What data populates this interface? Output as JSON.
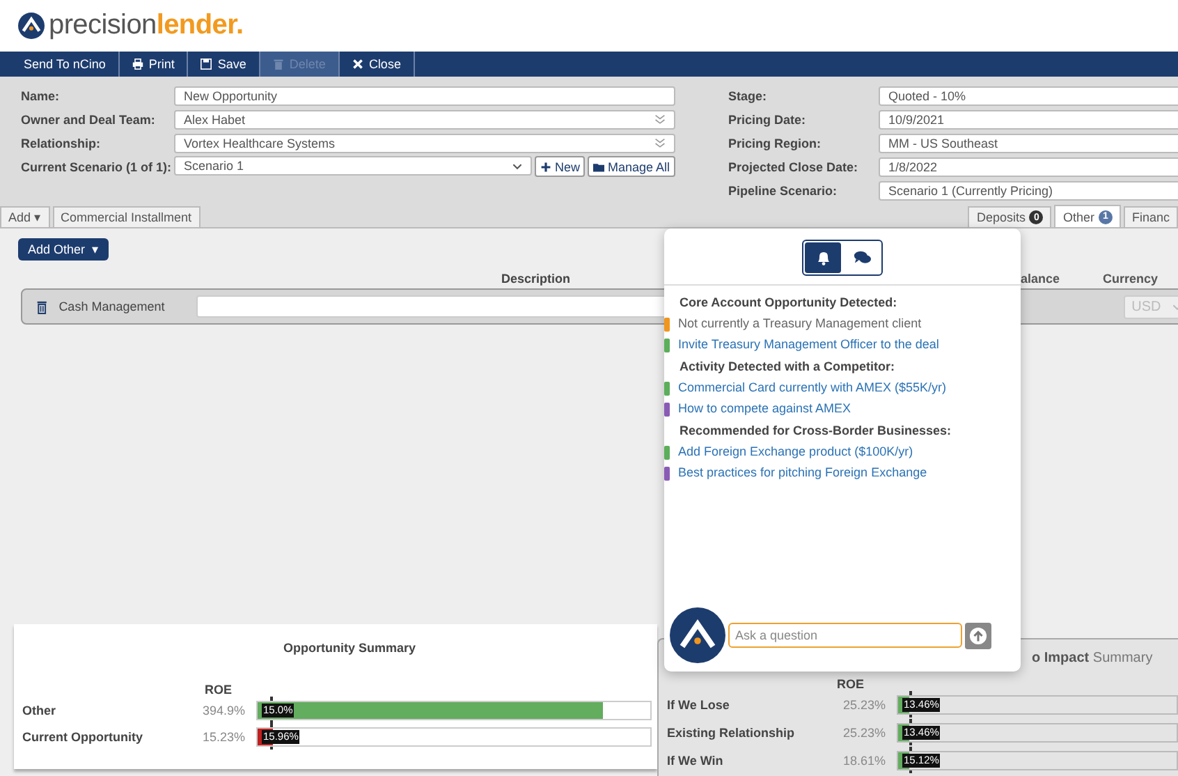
{
  "logo": {
    "first": "precision",
    "second": "lender."
  },
  "toolbar": [
    {
      "label": "Send To nCino",
      "disabled": false
    },
    {
      "label": "Print",
      "disabled": false
    },
    {
      "label": "Save",
      "disabled": false
    },
    {
      "label": "Delete",
      "disabled": true
    },
    {
      "label": "Close",
      "disabled": false
    }
  ],
  "form_left": [
    {
      "label": "Name:",
      "value": "New Opportunity",
      "kind": "text"
    },
    {
      "label": "Owner and Deal Team:",
      "value": "Alex Habet",
      "kind": "multi"
    },
    {
      "label": "Relationship:",
      "value": "Vortex Healthcare Systems",
      "kind": "multi"
    },
    {
      "label": "Current Scenario (1 of 1):",
      "value": "Scenario 1",
      "kind": "select"
    }
  ],
  "scenario_buttons": [
    {
      "label": "New"
    },
    {
      "label": "Manage All"
    }
  ],
  "form_right": [
    {
      "label": "Stage:",
      "value": "Quoted - 10%"
    },
    {
      "label": "Pricing Date:",
      "value": "10/9/2021"
    },
    {
      "label": "Pricing Region:",
      "value": "MM - US Southeast"
    },
    {
      "label": "Projected Close Date:",
      "value": "1/8/2022"
    },
    {
      "label": "Pipeline Scenario:",
      "value": "Scenario 1 (Currently Pricing)"
    }
  ],
  "add_menu": {
    "label": "Add",
    "caret": "▾"
  },
  "product_tabs": [
    {
      "label": "Commercial Installment",
      "selected": false
    }
  ],
  "category_tabs": [
    {
      "label": "Deposits",
      "badge": "0",
      "selected": false
    },
    {
      "label": "Other",
      "badge": "1",
      "selected": true
    },
    {
      "label": "Financ",
      "selected": false
    }
  ],
  "add_other": {
    "label": "Add Other",
    "caret": "▾"
  },
  "columns": {
    "description": "Description",
    "balance": "alance",
    "currency": "Currency"
  },
  "other_row": {
    "name": "Cash Management",
    "currency": "USD"
  },
  "opportunity_summary": {
    "title": "Opportunity Summary",
    "column": "ROE",
    "rows": [
      {
        "name": "Other",
        "roe": "394.9%",
        "level": 0.88,
        "marker": "15.0%",
        "kind": "good"
      },
      {
        "name": "Current Opportunity",
        "roe": "15.23%",
        "level": 0.04,
        "marker": "15.96%",
        "kind": "bad"
      }
    ]
  },
  "impact_summary": {
    "title_visible": "o Impact",
    "title_rest": "Summary",
    "column": "ROE",
    "rows": [
      {
        "name": "If We Lose",
        "roe": "25.23%",
        "level": 0.04,
        "marker": "13.46%",
        "kind": "good"
      },
      {
        "name": "Existing Relationship",
        "roe": "25.23%",
        "level": 0.04,
        "marker": "13.46%",
        "kind": "good"
      },
      {
        "name": "If We Win",
        "roe": "18.61%",
        "level": 0.04,
        "marker": "15.12%",
        "kind": "good"
      }
    ]
  },
  "assistant": {
    "modes": [
      {
        "selected": true
      },
      {
        "selected": false
      }
    ],
    "sections": [
      {
        "heading": "Core Account Opportunity Detected:",
        "items": [
          {
            "text": "Not currently a Treasury Management client",
            "kind": "note",
            "color": "#f0961e"
          },
          {
            "text": "Invite Treasury Management Officer to the deal",
            "kind": "link",
            "color": "#5cae5a"
          }
        ]
      },
      {
        "heading": "Activity Detected with a Competitor:",
        "items": [
          {
            "text": "Commercial Card currently with AMEX ($55K/yr)",
            "kind": "link",
            "color": "#5cae5a"
          },
          {
            "text": "How to compete against AMEX",
            "kind": "link",
            "color": "#8a5bb5"
          }
        ]
      },
      {
        "heading": "Recommended for Cross-Border Businesses:",
        "items": [
          {
            "text": "Add Foreign Exchange product ($100K/yr)",
            "kind": "link",
            "color": "#5cae5a"
          },
          {
            "text": "Best practices for pitching Foreign Exchange",
            "kind": "link",
            "color": "#8a5bb5"
          }
        ]
      }
    ],
    "input": {
      "placeholder": "Ask a question"
    }
  }
}
